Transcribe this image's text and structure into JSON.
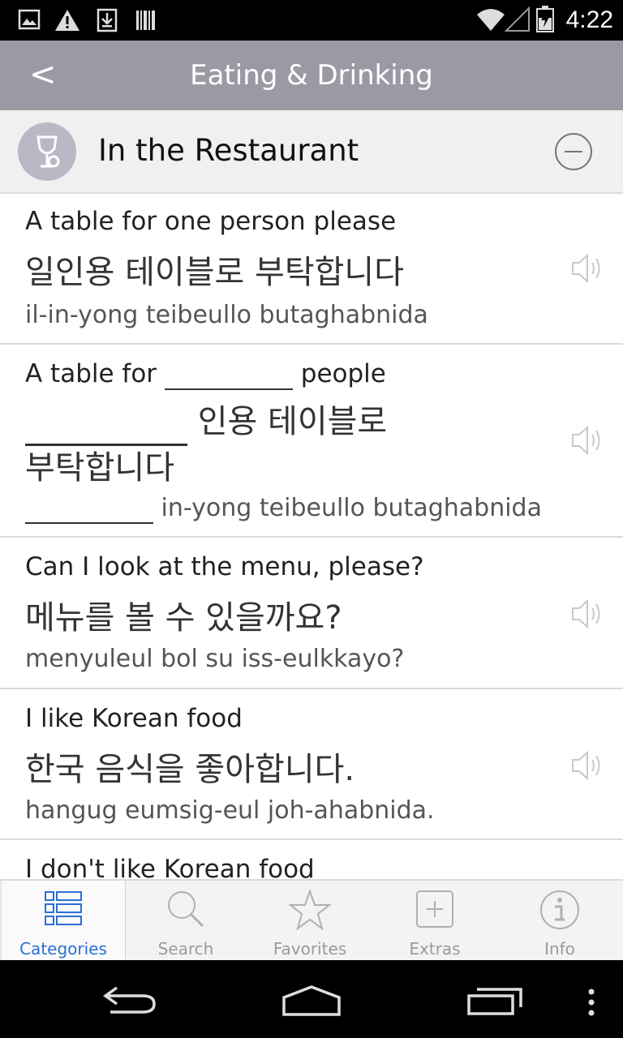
{
  "status_bar": {
    "time": "4:22",
    "icons": [
      "gallery-icon",
      "warning-icon",
      "download-icon",
      "barcode-icon",
      "wifi-icon",
      "signal-icon",
      "battery-icon"
    ]
  },
  "header": {
    "back_label": "<",
    "title": "Eating & Drinking"
  },
  "section": {
    "title": "In the Restaurant",
    "icon": "wine-glass-icon",
    "toggle_icon": "collapse-icon"
  },
  "phrases": [
    {
      "english": "A table for one person please",
      "korean": "일인용 테이블로 부탁합니다",
      "romanization": "il-in-yong teibeullo butaghabnida"
    },
    {
      "english_before": "A table for ",
      "english_after": " people",
      "korean_after": " 인용 테이블로",
      "korean_line2": "부탁합니다",
      "romanization_after": " in-yong teibeullo butaghabnida"
    },
    {
      "english": "Can I look at the menu, please?",
      "korean": "메뉴를 볼 수 있을까요?",
      "romanization": "menyuleul bol su iss-eulkkayo?"
    },
    {
      "english": "I like Korean food",
      "korean": "한국 음식을 좋아합니다.",
      "romanization": "hangug eumsig-eul joh-ahabnida."
    },
    {
      "english": "I don't like Korean food"
    }
  ],
  "tabs": [
    {
      "label": "Categories",
      "icon": "categories-icon",
      "active": true
    },
    {
      "label": "Search",
      "icon": "search-icon",
      "active": false
    },
    {
      "label": "Favorites",
      "icon": "star-icon",
      "active": false
    },
    {
      "label": "Extras",
      "icon": "plus-box-icon",
      "active": false
    },
    {
      "label": "Info",
      "icon": "info-icon",
      "active": false
    }
  ],
  "nav_bar": {
    "icons": [
      "back-nav-icon",
      "home-nav-icon",
      "recents-nav-icon",
      "menu-dots-icon"
    ]
  },
  "colors": {
    "header_bg": "#9a9aa5",
    "accent": "#2a6fd6",
    "section_bg": "#f0f0f0"
  }
}
